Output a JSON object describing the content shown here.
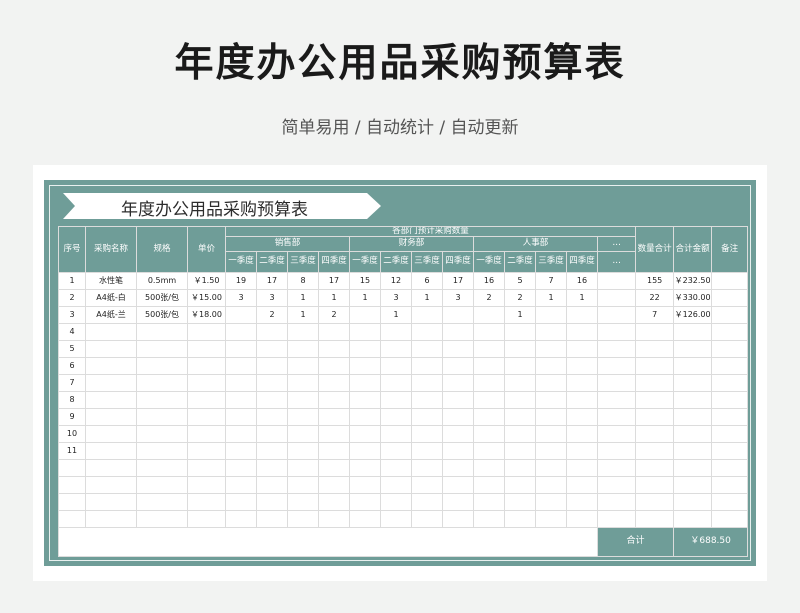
{
  "header": {
    "title": "年度办公用品采购预算表",
    "subtitle": "简单易用 / 自动统计 / 自动更新"
  },
  "sheet": {
    "banner_title": "年度办公用品采购预算表",
    "col_seq": "序号",
    "col_name": "采购名称",
    "col_spec": "规格",
    "col_price": "单价",
    "group_title": "各部门预计采购数量",
    "departments": [
      "销售部",
      "财务部",
      "人事部",
      "…"
    ],
    "quarters": [
      "一季度",
      "二季度",
      "三季度",
      "四季度"
    ],
    "more": "…",
    "col_qty": "数量合计",
    "col_amount": "合计金额",
    "col_note": "备注",
    "rows": [
      {
        "seq": "1",
        "name": "水性笔",
        "spec": "0.5mm",
        "price": "￥1.50",
        "q": [
          "19",
          "17",
          "8",
          "17",
          "15",
          "12",
          "6",
          "17",
          "16",
          "5",
          "7",
          "16",
          ""
        ],
        "qty": "155",
        "amount": "￥232.50",
        "note": ""
      },
      {
        "seq": "2",
        "name": "A4纸-白",
        "spec": "500张/包",
        "price": "￥15.00",
        "q": [
          "3",
          "3",
          "1",
          "1",
          "1",
          "3",
          "1",
          "3",
          "2",
          "2",
          "1",
          "1",
          ""
        ],
        "qty": "22",
        "amount": "￥330.00",
        "note": ""
      },
      {
        "seq": "3",
        "name": "A4纸-兰",
        "spec": "500张/包",
        "price": "￥18.00",
        "q": [
          "",
          "2",
          "1",
          "2",
          "",
          "1",
          "",
          "",
          "",
          "1",
          "",
          "",
          ""
        ],
        "qty": "7",
        "amount": "￥126.00",
        "note": ""
      },
      {
        "seq": "4",
        "name": "",
        "spec": "",
        "price": "",
        "q": [
          "",
          "",
          "",
          "",
          "",
          "",
          "",
          "",
          "",
          "",
          "",
          "",
          ""
        ],
        "qty": "",
        "amount": "",
        "note": ""
      },
      {
        "seq": "5",
        "name": "",
        "spec": "",
        "price": "",
        "q": [
          "",
          "",
          "",
          "",
          "",
          "",
          "",
          "",
          "",
          "",
          "",
          "",
          ""
        ],
        "qty": "",
        "amount": "",
        "note": ""
      },
      {
        "seq": "6",
        "name": "",
        "spec": "",
        "price": "",
        "q": [
          "",
          "",
          "",
          "",
          "",
          "",
          "",
          "",
          "",
          "",
          "",
          "",
          ""
        ],
        "qty": "",
        "amount": "",
        "note": ""
      },
      {
        "seq": "7",
        "name": "",
        "spec": "",
        "price": "",
        "q": [
          "",
          "",
          "",
          "",
          "",
          "",
          "",
          "",
          "",
          "",
          "",
          "",
          ""
        ],
        "qty": "",
        "amount": "",
        "note": ""
      },
      {
        "seq": "8",
        "name": "",
        "spec": "",
        "price": "",
        "q": [
          "",
          "",
          "",
          "",
          "",
          "",
          "",
          "",
          "",
          "",
          "",
          "",
          ""
        ],
        "qty": "",
        "amount": "",
        "note": ""
      },
      {
        "seq": "9",
        "name": "",
        "spec": "",
        "price": "",
        "q": [
          "",
          "",
          "",
          "",
          "",
          "",
          "",
          "",
          "",
          "",
          "",
          "",
          ""
        ],
        "qty": "",
        "amount": "",
        "note": ""
      },
      {
        "seq": "10",
        "name": "",
        "spec": "",
        "price": "",
        "q": [
          "",
          "",
          "",
          "",
          "",
          "",
          "",
          "",
          "",
          "",
          "",
          "",
          ""
        ],
        "qty": "",
        "amount": "",
        "note": ""
      },
      {
        "seq": "11",
        "name": "",
        "spec": "",
        "price": "",
        "q": [
          "",
          "",
          "",
          "",
          "",
          "",
          "",
          "",
          "",
          "",
          "",
          "",
          ""
        ],
        "qty": "",
        "amount": "",
        "note": ""
      },
      {
        "seq": "",
        "name": "",
        "spec": "",
        "price": "",
        "q": [
          "",
          "",
          "",
          "",
          "",
          "",
          "",
          "",
          "",
          "",
          "",
          "",
          ""
        ],
        "qty": "",
        "amount": "",
        "note": ""
      },
      {
        "seq": "",
        "name": "",
        "spec": "",
        "price": "",
        "q": [
          "",
          "",
          "",
          "",
          "",
          "",
          "",
          "",
          "",
          "",
          "",
          "",
          ""
        ],
        "qty": "",
        "amount": "",
        "note": ""
      },
      {
        "seq": "",
        "name": "",
        "spec": "",
        "price": "",
        "q": [
          "",
          "",
          "",
          "",
          "",
          "",
          "",
          "",
          "",
          "",
          "",
          "",
          ""
        ],
        "qty": "",
        "amount": "",
        "note": ""
      },
      {
        "seq": "",
        "name": "",
        "spec": "",
        "price": "",
        "q": [
          "",
          "",
          "",
          "",
          "",
          "",
          "",
          "",
          "",
          "",
          "",
          "",
          ""
        ],
        "qty": "",
        "amount": "",
        "note": ""
      }
    ],
    "total_label": "合计",
    "total_amount": "￥688.50",
    "accent_color": "#6f9d98"
  }
}
